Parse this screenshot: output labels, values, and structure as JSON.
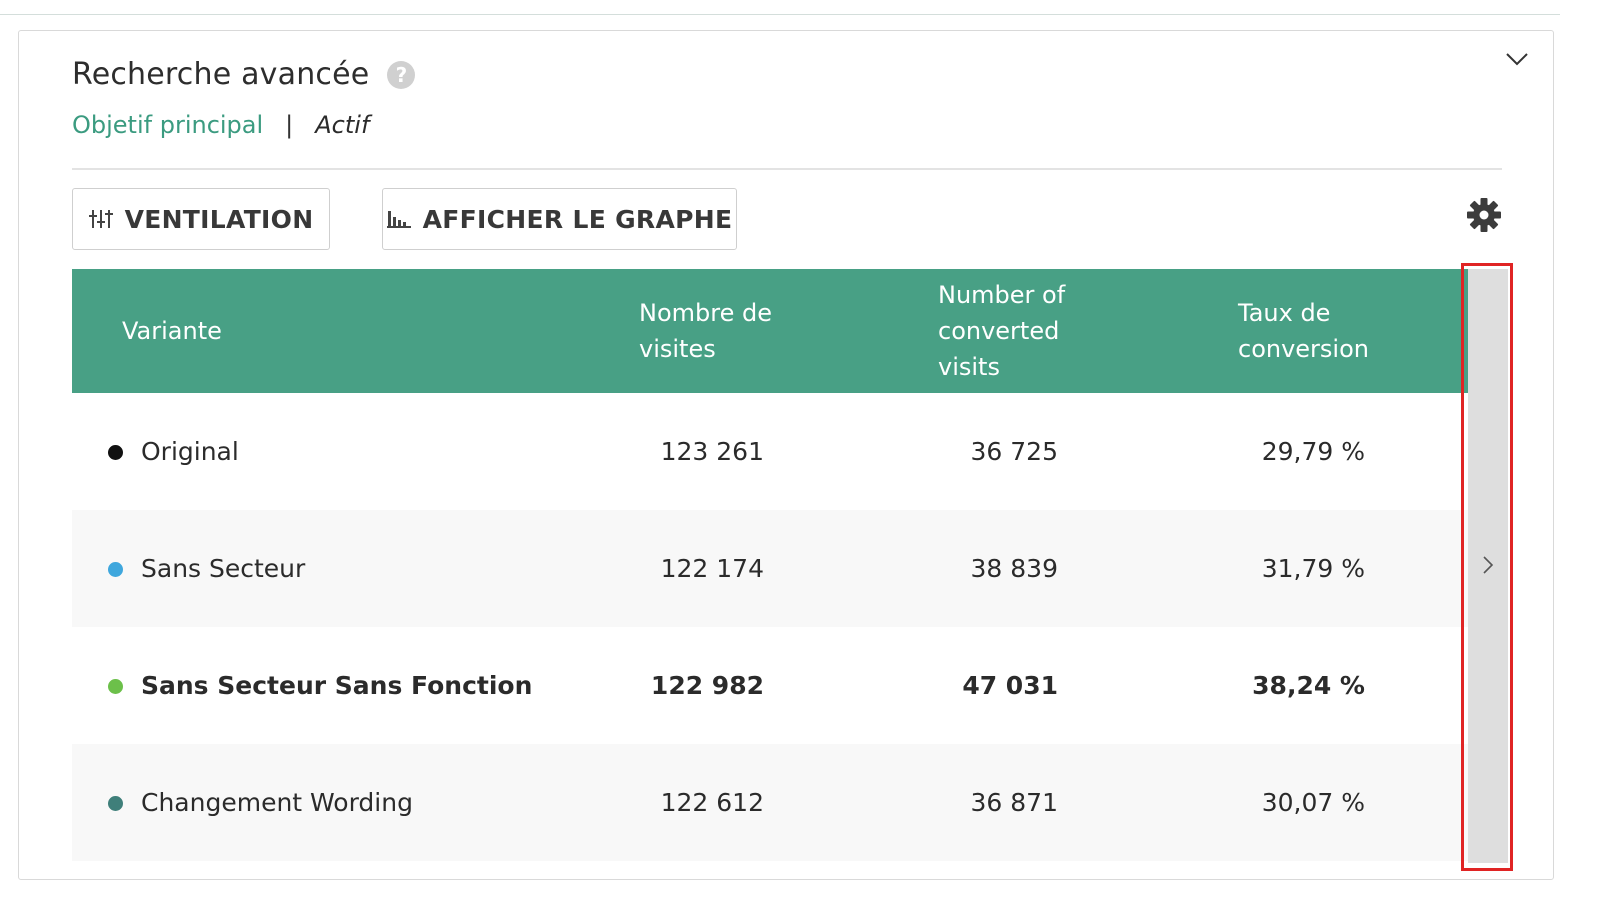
{
  "panel": {
    "title": "Recherche avancée",
    "objective_label": "Objetif principal",
    "separator": "|",
    "status": "Actif"
  },
  "toolbar": {
    "ventilation_label": "VENTILATION",
    "graph_label": "AFFICHER LE GRAPHE"
  },
  "table": {
    "headers": {
      "variant": "Variante",
      "visits": "Nombre de visites",
      "converted": "Number of converted visits",
      "rate": "Taux de conversion"
    },
    "rows": [
      {
        "name": "Original",
        "visits": "123 261",
        "converted": "36 725",
        "rate": "29,79 %",
        "dot_color": "#111111"
      },
      {
        "name": "Sans Secteur",
        "visits": "122 174",
        "converted": "38 839",
        "rate": "31,79 %",
        "dot_color": "#3fa7dd"
      },
      {
        "name": "Sans Secteur Sans Fonction",
        "visits": "122 982",
        "converted": "47 031",
        "rate": "38,24 %",
        "dot_color": "#6cc04a",
        "highlighted": true
      },
      {
        "name": "Changement Wording",
        "visits": "122 612",
        "converted": "36 871",
        "rate": "30,07 %",
        "dot_color": "#3f7f7a"
      }
    ]
  },
  "colors": {
    "accent": "#48a085",
    "link": "#3b9b80",
    "highlight_border": "#e02424"
  },
  "icons": {
    "help": "question-circle",
    "collapse": "chevron-down",
    "ventilation": "sliders",
    "graph": "bar-chart",
    "settings": "gear",
    "scroll": "chevron-right"
  }
}
